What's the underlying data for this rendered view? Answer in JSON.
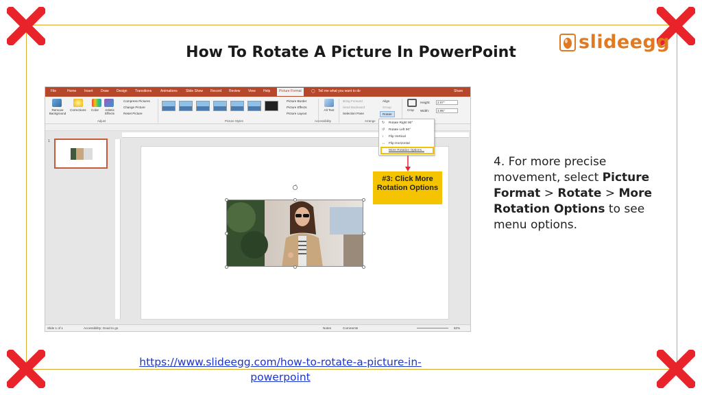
{
  "title": "How To Rotate A Picture In PowerPoint",
  "logo": {
    "text": "slideegg",
    "color": "#e07a22"
  },
  "colors": {
    "frame": "#d9a92e",
    "corner_x": "#e8232a",
    "highlight": "#f5c400",
    "ribbon_accent": "#b7472a",
    "link": "#1a35d0"
  },
  "screenshot": {
    "menu_tabs": [
      "File",
      "Home",
      "Insert",
      "Draw",
      "Design",
      "Transitions",
      "Animations",
      "Slide Show",
      "Record",
      "Review",
      "View",
      "Help",
      "Picture Format"
    ],
    "active_tab": "Picture Format",
    "tell_me": "Tell me what you want to do",
    "share": "Share",
    "ribbon": {
      "remove_background": "Remove Background",
      "corrections": "Corrections",
      "color": "Color",
      "artistic_effects": "Artistic Effects",
      "compress_pictures": "Compress Pictures",
      "change_picture": "Change Picture",
      "reset_picture": "Reset Picture",
      "picture_border": "Picture Border",
      "picture_effects": "Picture Effects",
      "picture_layout": "Picture Layout",
      "alt_text": "Alt Text",
      "bring_forward": "Bring Forward",
      "send_backward": "Send Backward",
      "selection_pane": "Selection Pane",
      "align": "Align",
      "group": "Group",
      "rotate": "Rotate",
      "crop": "Crop",
      "height_label": "Height:",
      "height_value": "2.07\"",
      "width_label": "Width:",
      "width_value": "3.95\"",
      "groups": {
        "adjust": "Adjust",
        "picture_styles": "Picture Styles",
        "accessibility": "Accessibility",
        "arrange": "Arrange"
      }
    },
    "rotate_menu": [
      "Rotate Right 90°",
      "Rotate Left 90°",
      "Flip Vertical",
      "Flip Horizontal",
      "More Rotation Options..."
    ],
    "slide_number": "1",
    "status": {
      "slide": "Slide 1 of 1",
      "accessibility": "Accessibility: Good to go",
      "notes": "Notes",
      "comments": "Comments",
      "zoom": "82%"
    }
  },
  "callout": {
    "prefix": "#3: Click",
    "text": "More Rotation Options"
  },
  "instruction": {
    "step": "4.",
    "intro": "For more precise movement, select",
    "picture_format": "Picture Format",
    "sep1": ">",
    "rotate": "Rotate",
    "sep2": ">",
    "more_rotation": "More Rotation Options",
    "outro": "to see menu options."
  },
  "link": {
    "text": "https://www.slideegg.com/how-to-rotate-a-picture-in-powerpoint"
  }
}
